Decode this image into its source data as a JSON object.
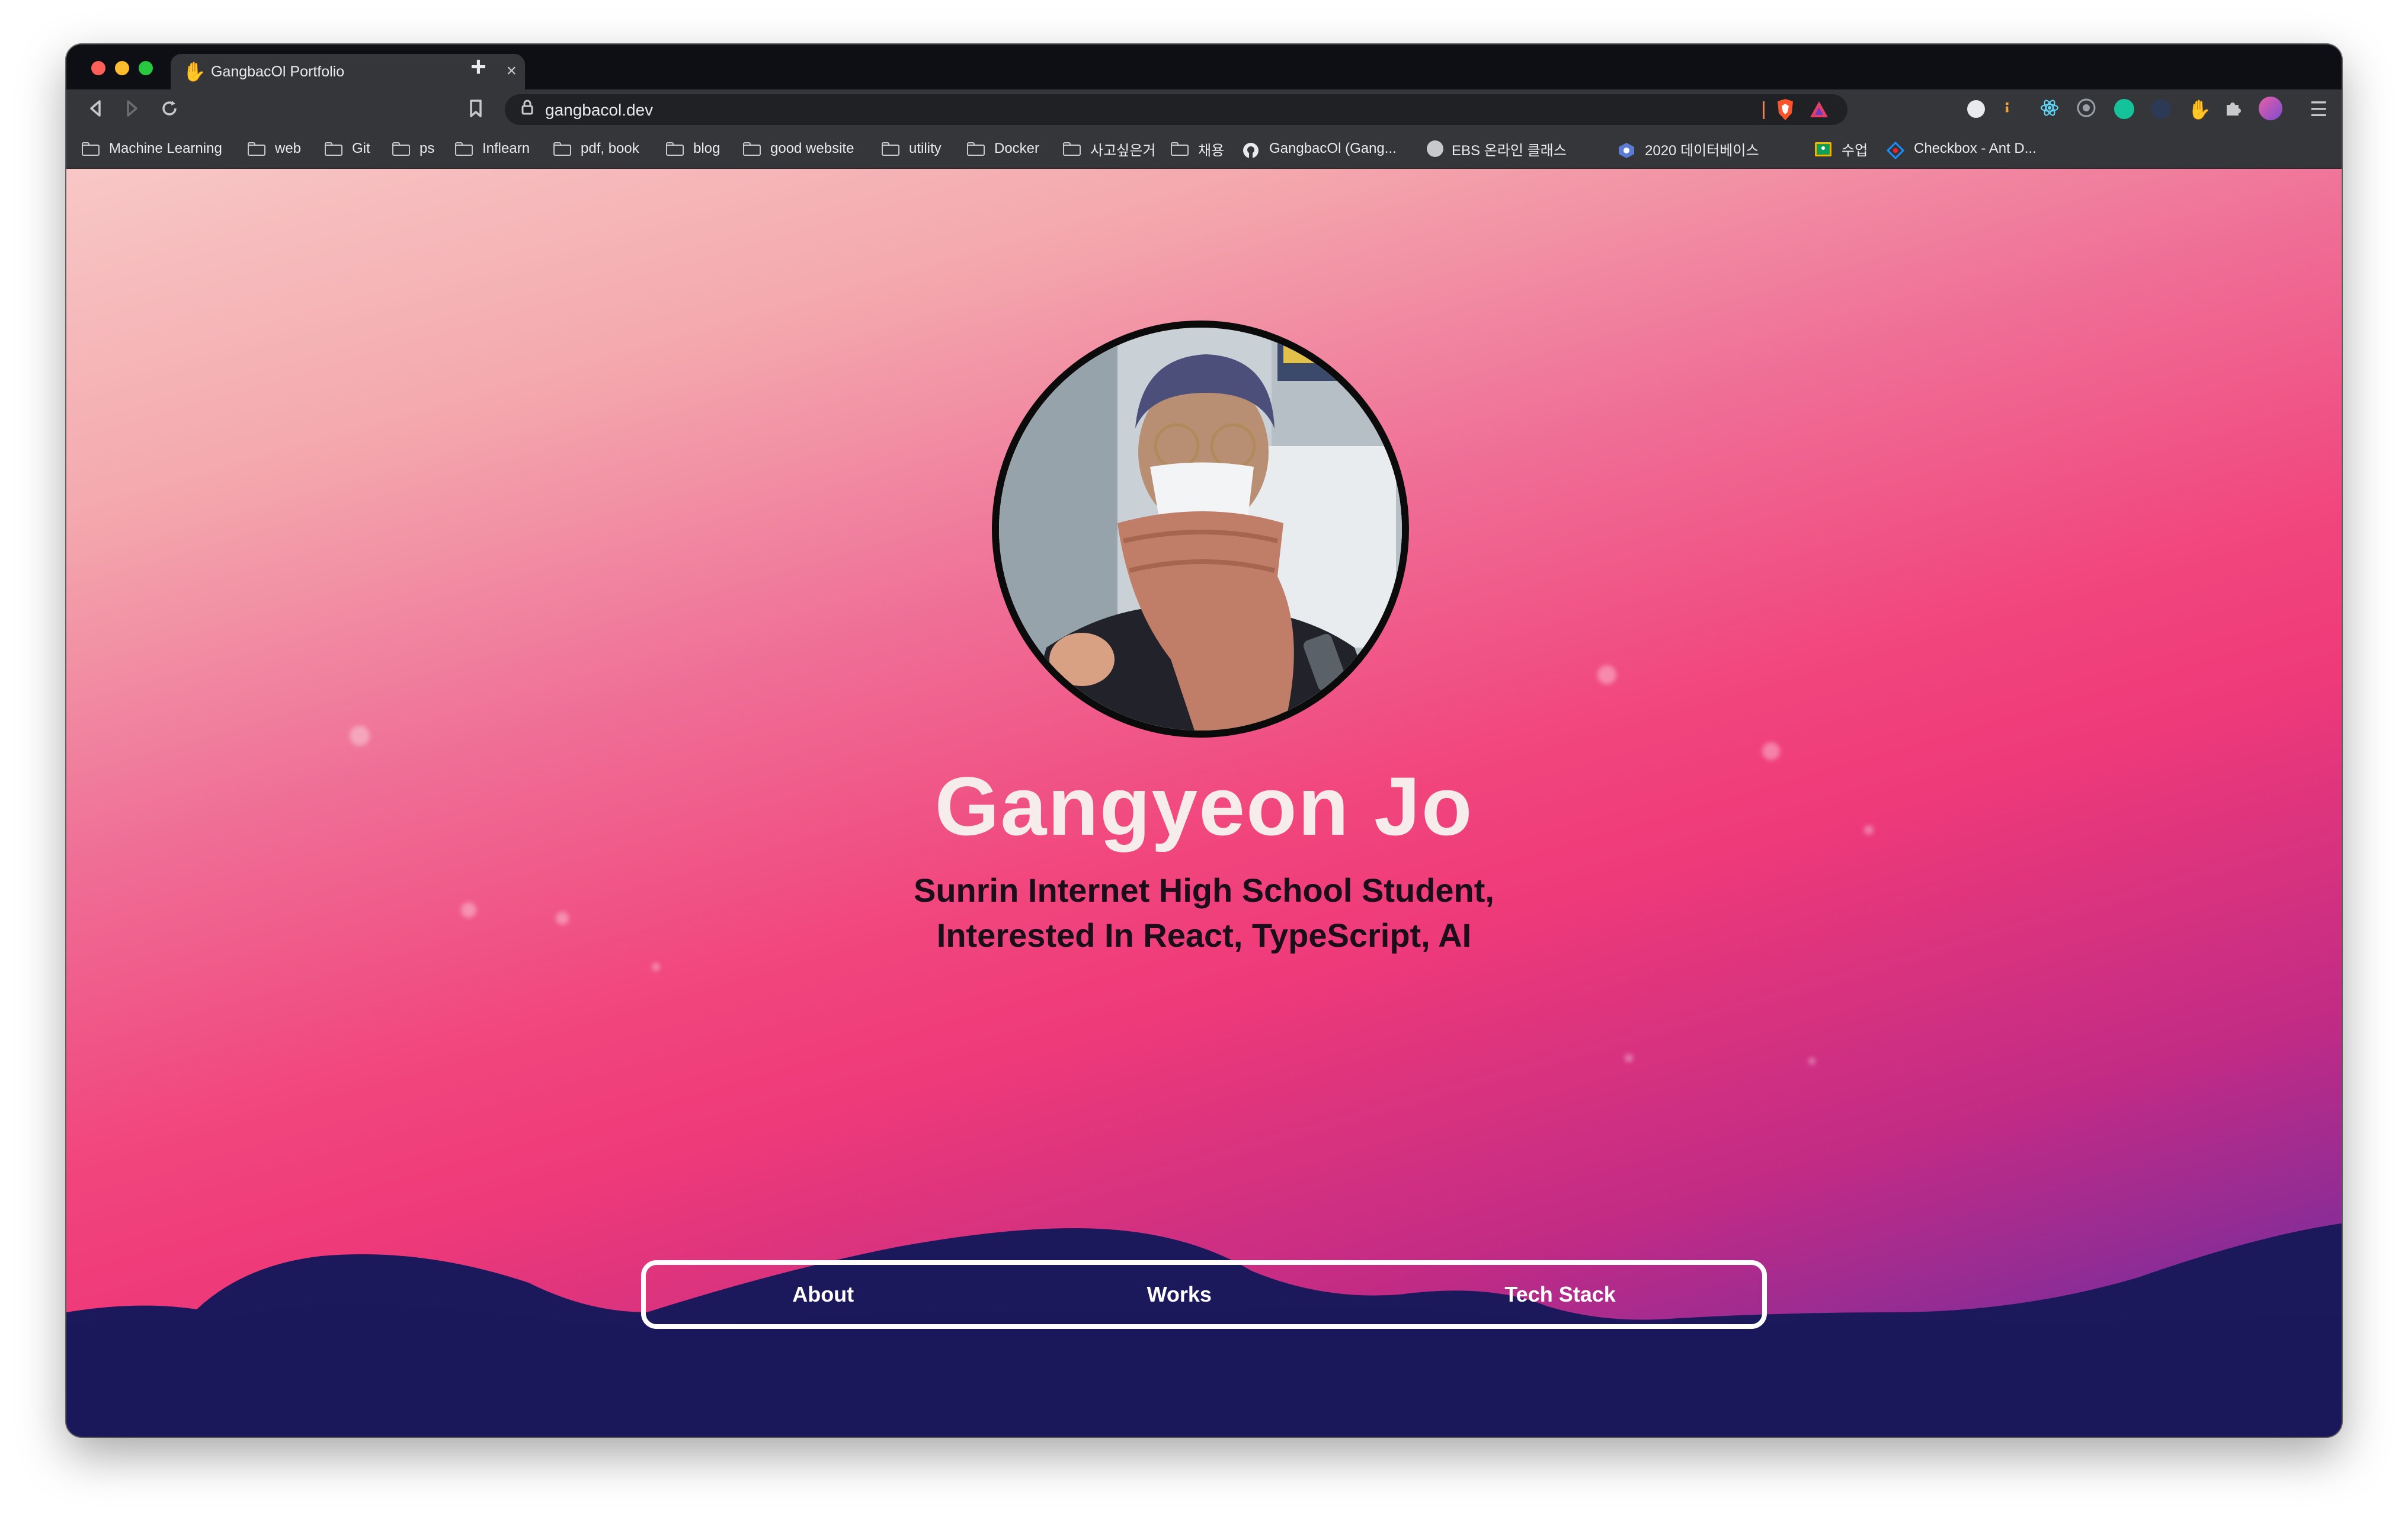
{
  "browser": {
    "tab": {
      "favicon": "waving-hand-icon",
      "title": "GangbacOl Portfolio",
      "close": "×"
    },
    "new_tab": "+",
    "url": "gangbacol.dev",
    "colors": {
      "tabstrip": "#0e0f14",
      "toolbar": "#35363a",
      "omnibox": "#202124"
    }
  },
  "bookmarks": [
    {
      "label": "Machine Learning",
      "icon": "folder-icon"
    },
    {
      "label": "web",
      "icon": "folder-icon"
    },
    {
      "label": "Git",
      "icon": "folder-icon"
    },
    {
      "label": "ps",
      "icon": "folder-icon"
    },
    {
      "label": "Inflearn",
      "icon": "folder-icon"
    },
    {
      "label": "pdf, book",
      "icon": "folder-icon"
    },
    {
      "label": "blog",
      "icon": "folder-icon"
    },
    {
      "label": "good website",
      "icon": "folder-icon"
    },
    {
      "label": "utility",
      "icon": "folder-icon"
    },
    {
      "label": "Docker",
      "icon": "folder-icon"
    },
    {
      "label": "사고싶은거",
      "icon": "folder-icon"
    },
    {
      "label": "채용",
      "icon": "folder-icon"
    },
    {
      "label": "GangbacOl (Gang...",
      "icon": "github-icon"
    },
    {
      "label": "EBS 온라인 클래스",
      "icon": "globe-icon"
    },
    {
      "label": "2020 데이터베이스",
      "icon": "class-icon"
    },
    {
      "label": "수업",
      "icon": "classroom-icon"
    },
    {
      "label": "Checkbox - Ant D...",
      "icon": "ant-design-icon"
    }
  ],
  "profile": {
    "name": "Gangyeon Jo",
    "bio_line1": "Sunrin Internet High School Student,",
    "bio_line2": "Interested In React, TypeScript, AI"
  },
  "nav": {
    "about": "About",
    "works": "Works",
    "tech_stack": "Tech Stack"
  },
  "colors": {
    "hero_top": "#f8c7c6",
    "hero_mid": "#ef3a79",
    "mountains": "#1c185c",
    "name_text": "#f7ecec"
  }
}
